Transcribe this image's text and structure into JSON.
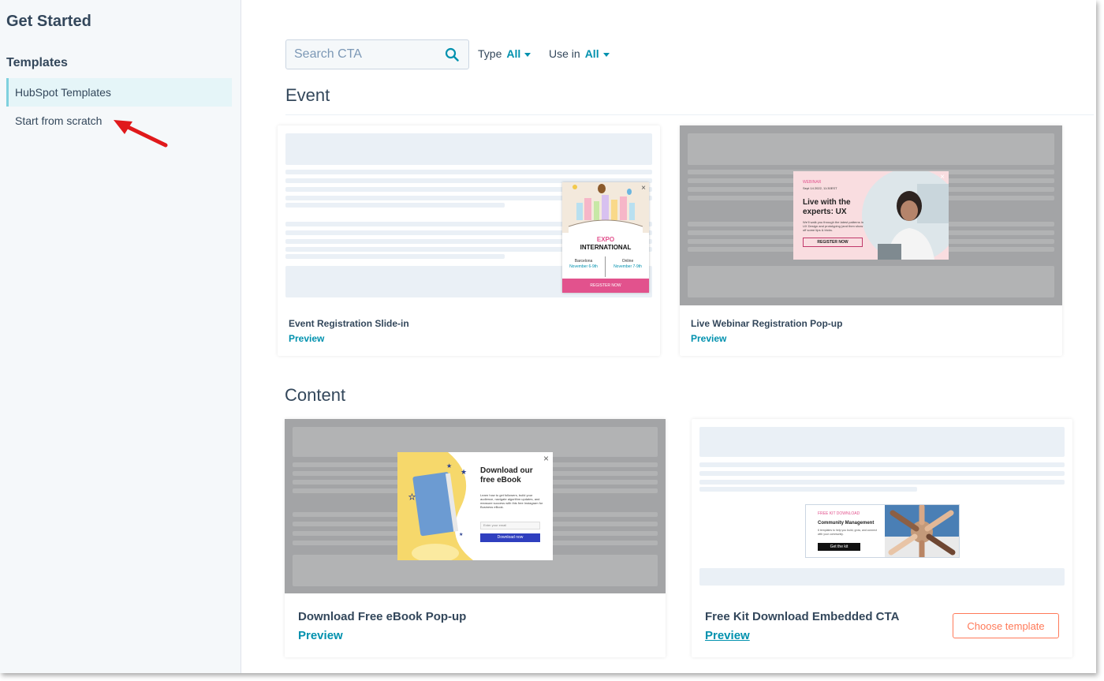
{
  "sidebar": {
    "title": "Get Started",
    "section": "Templates",
    "items": [
      {
        "label": "HubSpot Templates",
        "active": true
      },
      {
        "label": "Start from scratch",
        "active": false
      }
    ]
  },
  "toolbar": {
    "search_placeholder": "Search CTA",
    "type_label": "Type",
    "type_value": "All",
    "usein_label": "Use in",
    "usein_value": "All"
  },
  "sections": {
    "event": "Event",
    "content": "Content"
  },
  "cards": {
    "event_slidein": {
      "title": "Event Registration Slide-in",
      "preview": "Preview",
      "mini": {
        "line1": "EXPO",
        "line2": "INTERNATIONAL",
        "left_city": "Barcelona",
        "left_date": "November 6-9th",
        "right_city": "Online",
        "right_date": "November 7-9th",
        "cta": "REGISTER NOW"
      }
    },
    "webinar_popup": {
      "title": "Live Webinar Registration Pop-up",
      "preview": "Preview",
      "mini": {
        "tag": "WEBINAR",
        "date": "Sept 14 2022, 11:30EST",
        "heading1": "Live with the",
        "heading2": "experts: UX",
        "body": "We'll walk you through the latest patterns in UX Design and prototyping (and then show off some tips & tricks.",
        "cta": "REGISTER NOW"
      }
    },
    "ebook_popup": {
      "title": "Download Free eBook Pop-up",
      "preview": "Preview",
      "mini": {
        "heading1": "Download our",
        "heading2": "free eBook",
        "body": "Learn how to get followers, build your audience, navigate algorithm updates, and measure success with this free Instagram for Business eBook.",
        "email_placeholder": "Enter your email",
        "cta": "Download now"
      }
    },
    "kit_cta": {
      "title": "Free Kit Download Embedded CTA",
      "preview": "Preview",
      "choose": "Choose template",
      "mini": {
        "tag": "FREE KIT DOWNLOAD",
        "heading": "Community Management",
        "body": "6 templates to help you build, grow, and connect with your community.",
        "cta": "Get the kit"
      }
    }
  },
  "colors": {
    "accent": "#0091ae",
    "sidebar_bg": "#f5f8fa",
    "active_bg": "#e5f5f8",
    "active_border": "#7fd1de",
    "choose_btn": "#ff7a59",
    "overlay_gray": "#a3a4a6",
    "annotation_arrow": "#e0191b"
  }
}
